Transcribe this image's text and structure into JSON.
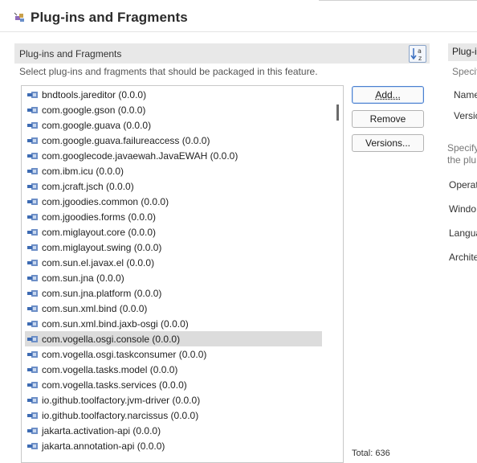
{
  "header": {
    "title": "Plug-ins and Fragments",
    "icon": "plugin-icon"
  },
  "section": {
    "title": "Plug-ins and Fragments",
    "description": "Select plug-ins and fragments that should be packaged in this feature.",
    "sort_icon": "sort-az-icon"
  },
  "list": {
    "items": [
      "bndtools.jareditor (0.0.0)",
      "com.google.gson (0.0.0)",
      "com.google.guava (0.0.0)",
      "com.google.guava.failureaccess (0.0.0)",
      "com.googlecode.javaewah.JavaEWAH (0.0.0)",
      "com.ibm.icu (0.0.0)",
      "com.jcraft.jsch (0.0.0)",
      "com.jgoodies.common (0.0.0)",
      "com.jgoodies.forms (0.0.0)",
      "com.miglayout.core (0.0.0)",
      "com.miglayout.swing (0.0.0)",
      "com.sun.el.javax.el (0.0.0)",
      "com.sun.jna (0.0.0)",
      "com.sun.jna.platform (0.0.0)",
      "com.sun.xml.bind (0.0.0)",
      "com.sun.xml.bind.jaxb-osgi (0.0.0)",
      "com.vogella.osgi.console (0.0.0)",
      "com.vogella.osgi.taskconsumer (0.0.0)",
      "com.vogella.tasks.model (0.0.0)",
      "com.vogella.tasks.services (0.0.0)",
      "io.github.toolfactory.jvm-driver (0.0.0)",
      "io.github.toolfactory.narcissus (0.0.0)",
      "jakarta.activation-api (0.0.0)",
      "jakarta.annotation-api (0.0.0)"
    ],
    "selected_index": 16
  },
  "buttons": {
    "add": "Add...",
    "remove": "Remove",
    "versions": "Versions..."
  },
  "total": "Total: 636",
  "right_panel": {
    "title": "Plug-i",
    "specif1": "Specif",
    "name": "Name",
    "version": "Versic",
    "specify": "Specify",
    "the_plu": "the plu",
    "operating": "Operat",
    "window": "Windo",
    "language": "Langua",
    "architecture": "Archite"
  },
  "colors": {
    "selection": "#dcdcdc",
    "section_bar": "#e8e8e8",
    "default_button_border": "#4a7fcf"
  }
}
